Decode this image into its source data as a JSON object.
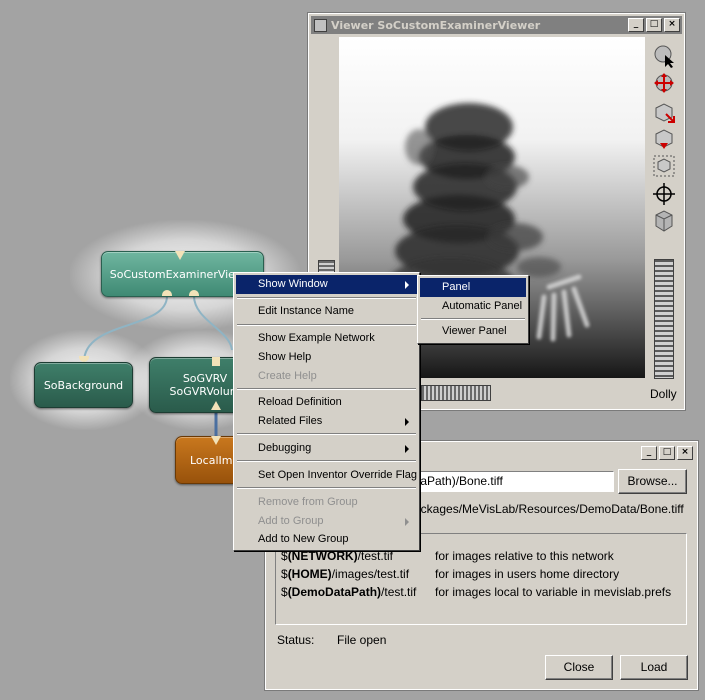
{
  "network": {
    "modules": {
      "examiner": "SoCustomExaminerViewer",
      "background": "SoBackground",
      "gvr_line1": "SoGVRV",
      "gvr_line2": "SoGVRVolum",
      "local": "LocalIma"
    }
  },
  "viewer_window": {
    "title": "Viewer SoCustomExaminerViewer",
    "controls": [
      "_",
      "□",
      "×"
    ],
    "tools": [
      "pick-arrow-icon",
      "rotate-icon",
      "seek-icon",
      "home-icon",
      "view-all-icon",
      "set-home-icon",
      "perspective-cube-icon"
    ],
    "dolly_label": "Dolly"
  },
  "file_window": {
    "controls": [
      "_",
      "□",
      "×"
    ],
    "filename_value": "taPath)/Bone.tiff",
    "browse_label": "Browse...",
    "resolved_path": "ackages/MeVisLab/Resources/DemoData/Bone.tiff",
    "help_rows": [
      {
        "prefix": "$",
        "var": "(NETWORK)",
        "rest": "/test.tif",
        "desc": "for images relative to this network"
      },
      {
        "prefix": "$",
        "var": "(HOME)",
        "rest": "/images/test.tif",
        "desc": "for images in users home directory"
      },
      {
        "prefix": "$",
        "var": "(DemoDataPath)",
        "rest": "/test.tif",
        "desc": "for images local to variable in mevislab.prefs"
      }
    ],
    "status_label": "Status:",
    "status_value": "File open",
    "close_label": "Close",
    "load_label": "Load"
  },
  "context_menu": {
    "items": [
      {
        "label": "Show Window"
      },
      {
        "label": "Edit Instance Name"
      },
      {
        "label": "Show Example Network"
      },
      {
        "label": "Show Help"
      },
      {
        "label": "Create Help"
      },
      {
        "label": "Reload Definition"
      },
      {
        "label": "Related Files"
      },
      {
        "label": "Debugging"
      },
      {
        "label": "Set Open Inventor Override Flag"
      },
      {
        "label": "Remove from Group"
      },
      {
        "label": "Add to Group"
      },
      {
        "label": "Add to New Group"
      }
    ]
  },
  "submenu": {
    "items": [
      {
        "label": "Panel"
      },
      {
        "label": "Automatic Panel"
      },
      {
        "label": "Viewer Panel"
      }
    ]
  },
  "colors": {
    "menu_highlight": "#0a246a",
    "module_green": "#2f6353",
    "module_orange": "#b0640f",
    "inactive_titlebar": "#808080"
  }
}
